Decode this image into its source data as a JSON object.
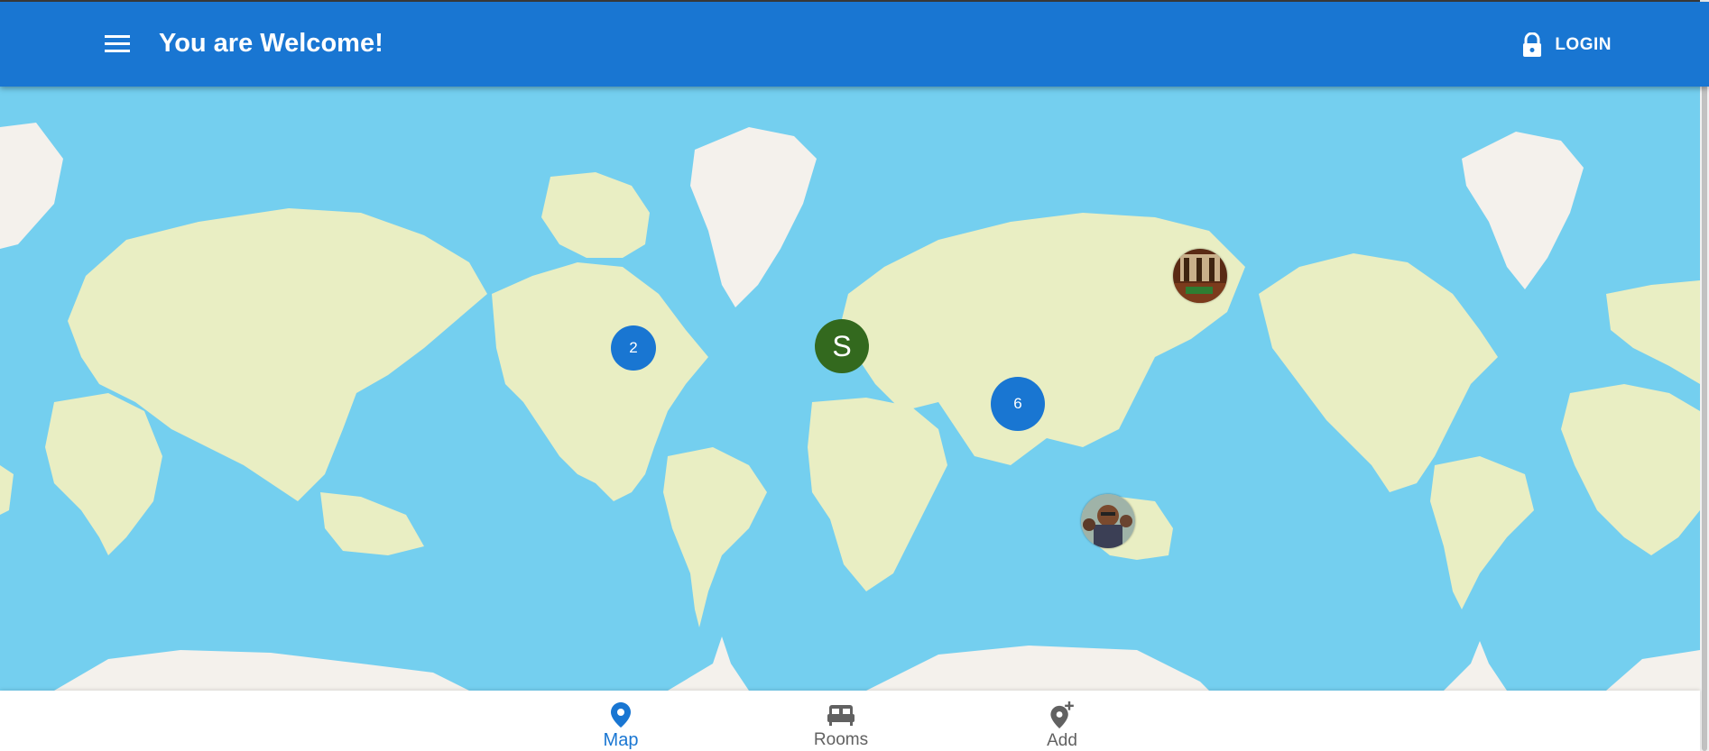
{
  "appbar": {
    "title": "You are Welcome!",
    "menu_icon": "hamburger-menu-icon",
    "login_label": "LOGIN",
    "login_icon": "lock-icon",
    "color": "#1976d2"
  },
  "map": {
    "ocean_color": "#74cfef",
    "land_color": "#e9eec3",
    "ice_color": "#f4f1ec",
    "markers": [
      {
        "type": "cluster",
        "count": "2"
      },
      {
        "type": "avatar",
        "letter": "S",
        "color": "#33691e"
      },
      {
        "type": "cluster",
        "count": "6"
      },
      {
        "type": "photo",
        "subject": "room-photo"
      },
      {
        "type": "photo",
        "subject": "people-photo"
      }
    ]
  },
  "bottom_nav": {
    "items": [
      {
        "label": "Map",
        "icon": "map-pin-icon",
        "active": true
      },
      {
        "label": "Rooms",
        "icon": "bed-icon",
        "active": false
      },
      {
        "label": "Add",
        "icon": "add-location-icon",
        "active": false
      }
    ]
  }
}
